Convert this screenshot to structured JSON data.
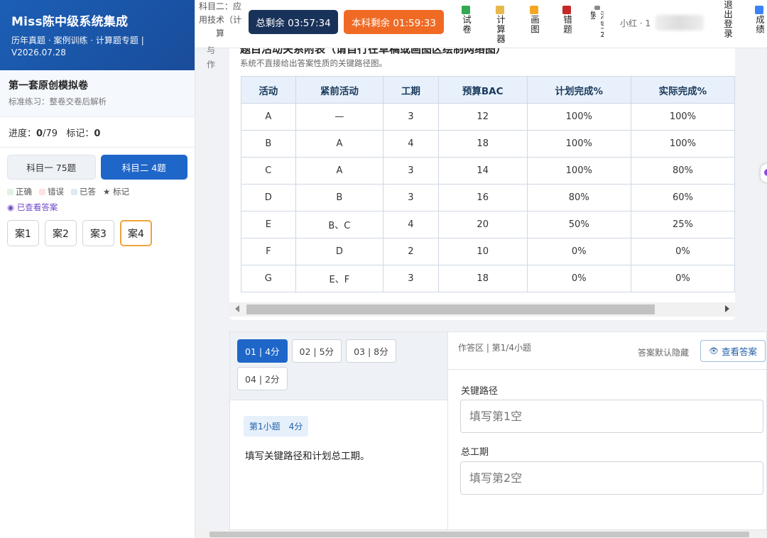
{
  "brand": {
    "title": "Miss陈中级系统集成",
    "subtitle": "历年真题 · 案例训练 · 计算题专题 | V2026.07.28"
  },
  "exam": {
    "name": "第一套原创模拟卷",
    "desc": "标准练习：整卷交卷后解析"
  },
  "progress": {
    "label": "进度：",
    "done": "0",
    "total": "/79",
    "mark_label": "标记：",
    "marks": "0"
  },
  "subjects": [
    {
      "label": "科目一 75题"
    },
    {
      "label": "科目二 4题"
    }
  ],
  "legend": [
    {
      "label": "正确",
      "color": "#dff3e4"
    },
    {
      "label": "错误",
      "color": "#fde2e2"
    },
    {
      "label": "已答",
      "color": "#dde9f8"
    },
    {
      "label": "★ 标记",
      "color": ""
    }
  ],
  "viewed_label": "◉ 已查看答案",
  "cases": [
    "案1",
    "案2",
    "案3",
    "案4"
  ],
  "topbar": {
    "subject_info": "科目二：应用技术（计算",
    "timer_total": "总剩余 03:57:34",
    "timer_subject": "本科剩余 01:59:33",
    "tools": [
      {
        "label": "试卷",
        "color": "#34a853"
      },
      {
        "label": "计算器",
        "color": "#e8b84a"
      },
      {
        "label": "画图",
        "color": "#f5a623"
      },
      {
        "label": "错题",
        "color": "#c62828"
      },
      {
        "label": "清空本卷",
        "color": "#888888"
      },
      {
        "label": "退出登录",
        "color": ""
      },
      {
        "label": "成绩",
        "color": "#3b82f6"
      }
    ],
    "user": "小红 · 1"
  },
  "left_edge": [
    "与",
    "作"
  ],
  "table": {
    "title": "题目活动关系附表（请自行在草稿或画图区绘制网络图）",
    "note": "系统不直接给出答案性质的关键路径图。",
    "headers": [
      "活动",
      "紧前活动",
      "工期",
      "预算BAC",
      "计划完成%",
      "实际完成%"
    ],
    "rows": [
      [
        "A",
        "—",
        "3",
        "12",
        "100%",
        "100%"
      ],
      [
        "B",
        "A",
        "4",
        "18",
        "100%",
        "100%"
      ],
      [
        "C",
        "A",
        "3",
        "14",
        "100%",
        "80%"
      ],
      [
        "D",
        "B",
        "3",
        "16",
        "80%",
        "60%"
      ],
      [
        "E",
        "B、C",
        "4",
        "20",
        "50%",
        "25%"
      ],
      [
        "F",
        "D",
        "2",
        "10",
        "0%",
        "0%"
      ],
      [
        "G",
        "E、F",
        "3",
        "18",
        "0%",
        "0%"
      ]
    ]
  },
  "question": {
    "tabs": [
      "01 | 4分",
      "02 | 5分",
      "03 | 8分",
      "04 | 2分"
    ],
    "badge": "第1小题　4分",
    "text": "填写关键路径和计划总工期。"
  },
  "answer": {
    "title": "作答区 | 第1/4小题",
    "hint": "答案默认隐藏",
    "view_button": "查看答案",
    "fields": [
      {
        "label": "关键路径",
        "placeholder": "填写第1空"
      },
      {
        "label": "总工期",
        "placeholder": "填写第2空"
      }
    ]
  }
}
